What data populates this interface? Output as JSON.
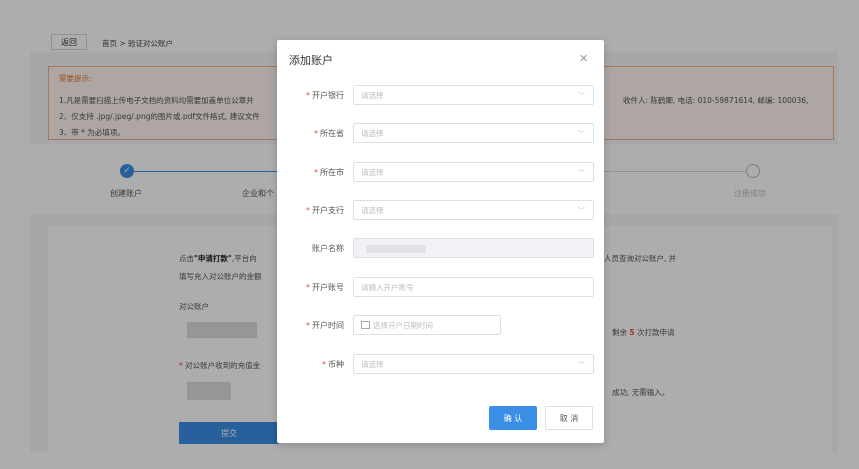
{
  "topbar": {
    "back_label": "返回",
    "breadcrumb": "首页 > 验证对公账户"
  },
  "tip": {
    "title": "需要提示:",
    "line1": "1.凡是需要扫描上传电子文档的资料均需要加盖单位公章并",
    "line1_right": "收件人: 陈鹤卿, 电话: 010-59871614, 邮编: 100036,",
    "line2": "2、仅支持 .jpg/.jpeg/.png的图片或.pdf文件格式, 建议文件",
    "line3": "3、带 * 为必填项。"
  },
  "steps": {
    "step1": "创建账户",
    "step2": "企业和个",
    "step_last": "注册成功"
  },
  "main": {
    "p1_left": "点击",
    "p1_bold": "\"申请打款\"",
    "p1_rest": ",平台向",
    "p1_right": "人员查询对公账户, 并",
    "p2": "填写充入对公账户的金额",
    "account_label": "对公账户",
    "remaining_prefix": "剩余",
    "remaining_count": "5",
    "remaining_suffix": "次打款申请",
    "amount_label": "对公账户收到的充值金",
    "success_text": "成功, 无需输入。",
    "submit_label": "提交"
  },
  "modal": {
    "title": "添加账户",
    "fields": {
      "bank": {
        "label": "开户银行",
        "placeholder": "请选择"
      },
      "province": {
        "label": "所在省",
        "placeholder": "请选择"
      },
      "city": {
        "label": "所在市",
        "placeholder": "请选择"
      },
      "branch": {
        "label": "开户支行",
        "placeholder": "请选择"
      },
      "account_name": {
        "label": "账户名称"
      },
      "account_number": {
        "label": "开户账号",
        "placeholder": "请输入开户账号"
      },
      "open_date": {
        "label": "开户时间",
        "placeholder": "选择开户日期时间"
      },
      "currency": {
        "label": "币种",
        "placeholder": "请选择"
      }
    },
    "confirm_label": "确 认",
    "cancel_label": "取 消"
  },
  "colors": {
    "primary": "#3a8ee6",
    "required": "#e74c3c",
    "tip_border": "#f3b08c"
  },
  "icons": {
    "close": "close-icon",
    "chevron": "chevron-down-icon",
    "calendar": "calendar-icon",
    "check": "check-icon"
  }
}
